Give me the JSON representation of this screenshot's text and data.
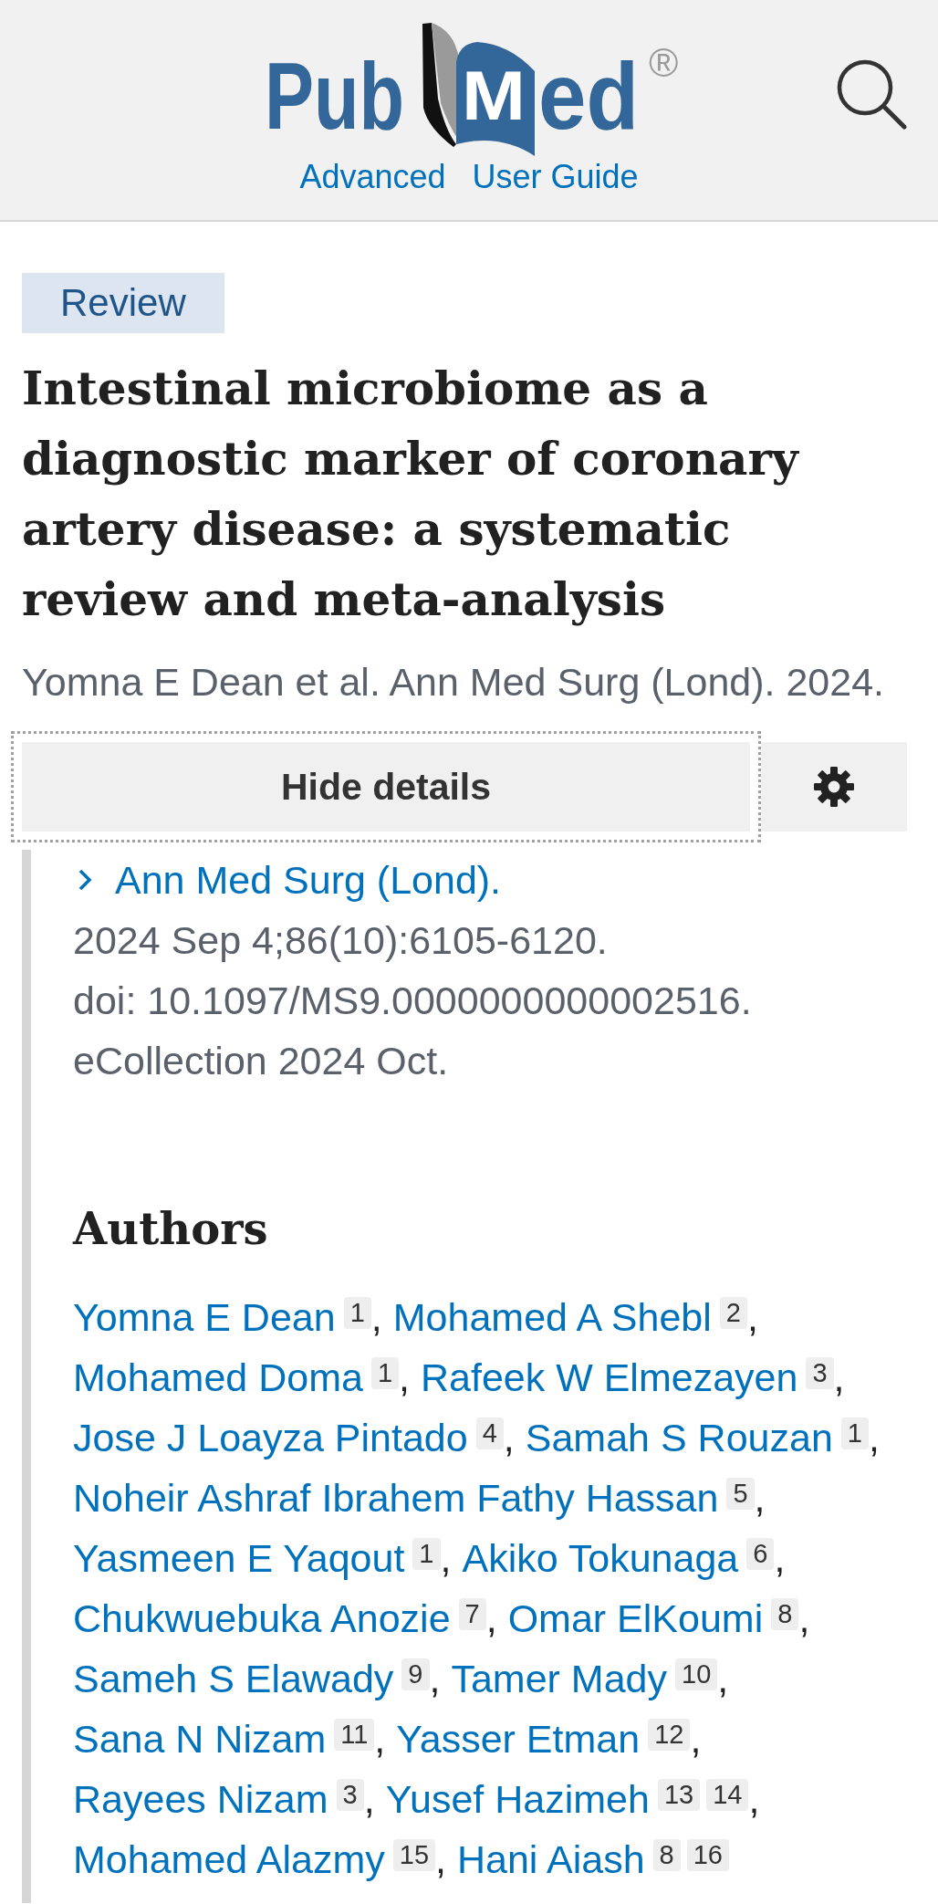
{
  "header": {
    "logo": {
      "prefix": "Pub",
      "book_letter": "M",
      "suffix": "ed",
      "registered_mark": "®"
    },
    "links": [
      {
        "label": "Advanced"
      },
      {
        "label": "User Guide"
      }
    ]
  },
  "article": {
    "publication_type": "Review",
    "title": "Intestinal microbiome as a diagnostic marker of coronary artery disease: a systematic review and meta-analysis",
    "citation": "Yomna E Dean et al. Ann Med Surg (Lond). 2024."
  },
  "actions": {
    "details_button": {
      "label": "Hide details",
      "focused": true
    }
  },
  "details": {
    "journal": "Ann Med Surg (Lond).",
    "lines": [
      "2024 Sep 4;86(10):6105-6120.",
      "doi: 10.1097/MS9.0000000000002516.",
      "eCollection 2024 Oct."
    ]
  },
  "authors": {
    "heading": "Authors",
    "list": [
      {
        "name": "Yomna E Dean",
        "affiliations": [
          "1"
        ],
        "separator": ","
      },
      {
        "name": "Mohamed A Shebl",
        "affiliations": [
          "2"
        ],
        "separator": ","
      },
      {
        "name": "Mohamed Doma",
        "affiliations": [
          "1"
        ],
        "separator": ","
      },
      {
        "name": "Rafeek W Elmezayen",
        "affiliations": [
          "3"
        ],
        "separator": ","
      },
      {
        "name": "Jose J Loayza Pintado",
        "affiliations": [
          "4"
        ],
        "separator": ","
      },
      {
        "name": "Samah S Rouzan",
        "affiliations": [
          "1"
        ],
        "separator": ","
      },
      {
        "name": "Noheir Ashraf Ibrahem Fathy Hassan",
        "affiliations": [
          "5"
        ],
        "separator": ","
      },
      {
        "name": "Yasmeen E Yaqout",
        "affiliations": [
          "1"
        ],
        "separator": ","
      },
      {
        "name": "Akiko Tokunaga",
        "affiliations": [
          "6"
        ],
        "separator": ","
      },
      {
        "name": "Chukwuebuka Anozie",
        "affiliations": [
          "7"
        ],
        "separator": ","
      },
      {
        "name": "Omar ElKoumi",
        "affiliations": [
          "8"
        ],
        "separator": ","
      },
      {
        "name": "Sameh S Elawady",
        "affiliations": [
          "9"
        ],
        "separator": ","
      },
      {
        "name": "Tamer Mady",
        "affiliations": [
          "10"
        ],
        "separator": ","
      },
      {
        "name": "Sana N Nizam",
        "affiliations": [
          "11"
        ],
        "separator": ","
      },
      {
        "name": "Yasser Etman",
        "affiliations": [
          "12"
        ],
        "separator": ","
      },
      {
        "name": "Rayees Nizam",
        "affiliations": [
          "3"
        ],
        "separator": ","
      },
      {
        "name": "Yusef Hazimeh",
        "affiliations": [
          "13",
          "14"
        ],
        "separator": ","
      },
      {
        "name": "Mohamed Alazmy",
        "affiliations": [
          "15"
        ],
        "separator": ","
      },
      {
        "name": "Hani Aiash",
        "affiliations": [
          "8",
          "16"
        ]
      }
    ]
  }
}
